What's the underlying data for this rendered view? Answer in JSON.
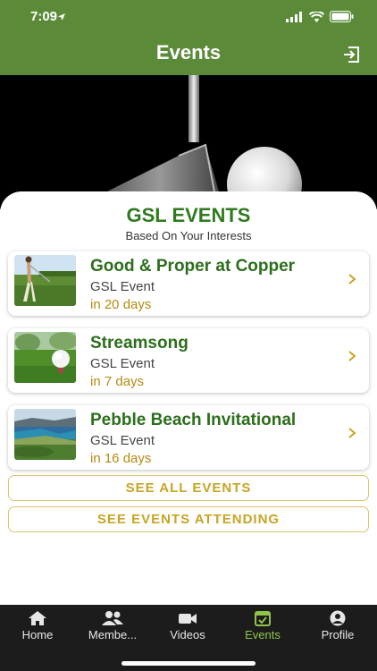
{
  "status_bar": {
    "time": "7:09"
  },
  "header": {
    "title": "Events",
    "logout_icon": "logout-icon"
  },
  "panel": {
    "title": "GSL EVENTS",
    "subtitle": "Based On Your Interests"
  },
  "events": [
    {
      "title": "Good & Proper at Copper",
      "type": "GSL Event",
      "when": "in 20 days",
      "thumb_icon": "golfer-image"
    },
    {
      "title": "Streamsong",
      "type": "GSL Event",
      "when": "in 7 days",
      "thumb_icon": "golf-ball-tee-image"
    },
    {
      "title": "Pebble Beach Invitational",
      "type": "GSL Event",
      "when": "in 16 days",
      "thumb_icon": "coastline-image"
    }
  ],
  "buttons": {
    "see_all": "SEE ALL EVENTS",
    "see_attending": "SEE EVENTS ATTENDING"
  },
  "tabs": [
    {
      "label": "Home",
      "icon": "home-icon"
    },
    {
      "label": "Membe...",
      "icon": "members-icon"
    },
    {
      "label": "Videos",
      "icon": "video-icon"
    },
    {
      "label": "Events",
      "icon": "calendar-icon",
      "active": true
    },
    {
      "label": "Profile",
      "icon": "profile-icon"
    }
  ],
  "colors": {
    "header": "#5b8b39",
    "title_green": "#2f7a1f",
    "accent_gold": "#c8a425",
    "active_tab": "#8fc449",
    "tabbar": "#1c1c1c"
  }
}
